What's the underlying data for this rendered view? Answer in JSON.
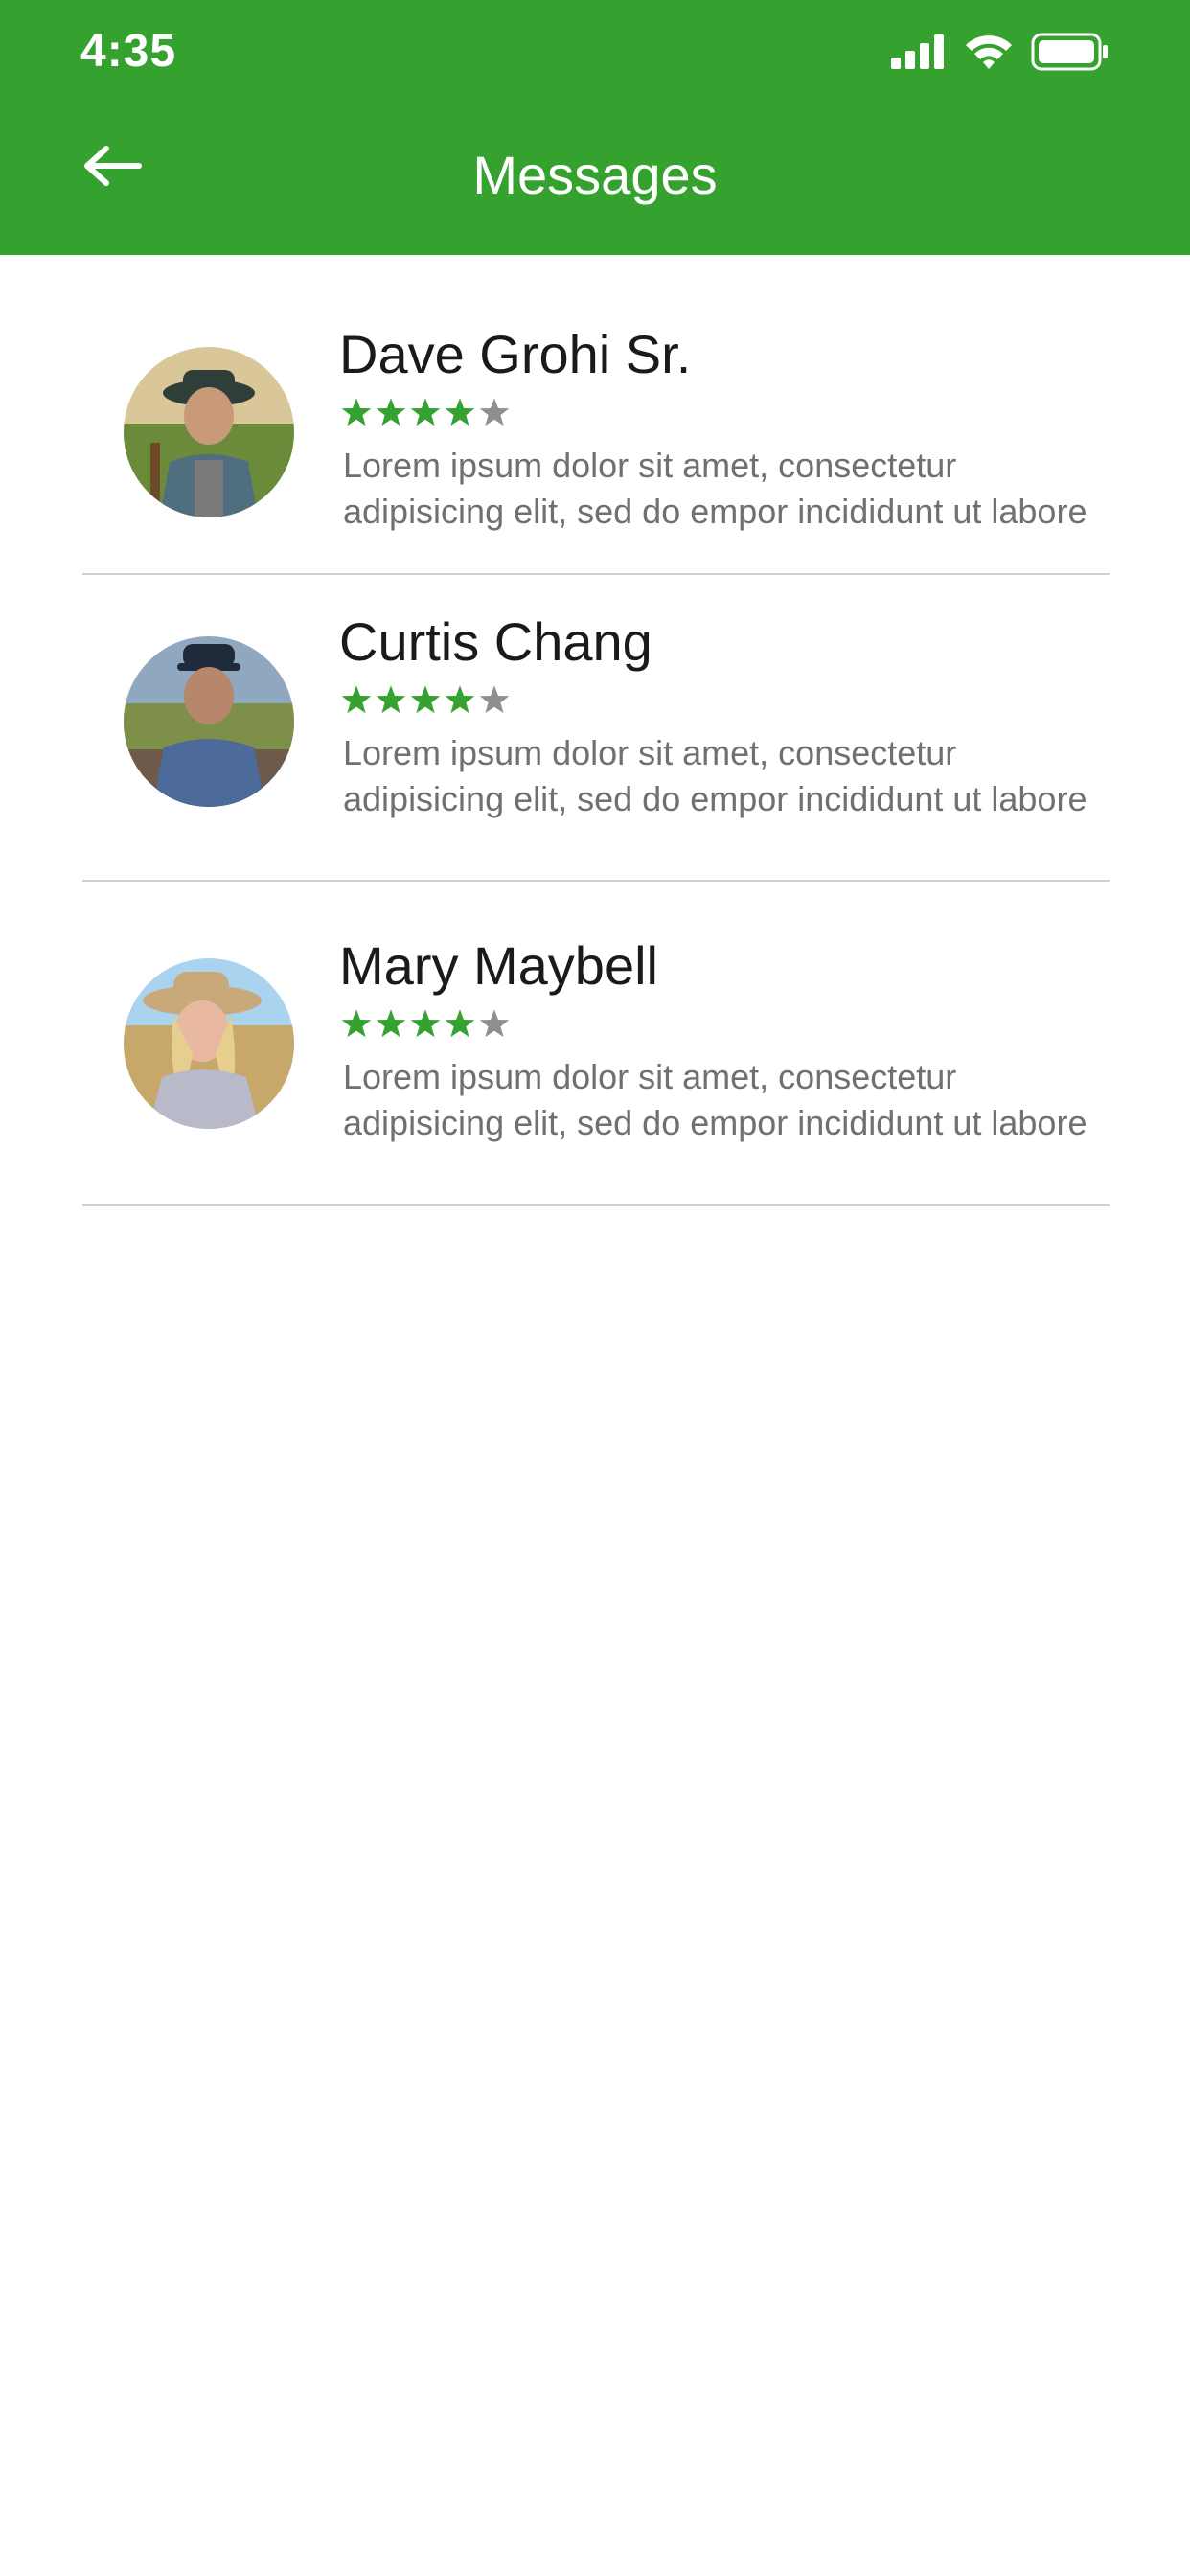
{
  "status_bar": {
    "time": "4:35",
    "icons": [
      "cellular-signal-icon",
      "wifi-icon",
      "battery-icon"
    ]
  },
  "header": {
    "title": "Messages",
    "back_icon": "arrow-left-icon",
    "background_color": "#35a22f"
  },
  "colors": {
    "accent": "#35a22f",
    "star_filled": "#35a22f",
    "star_empty": "#8f8f8f",
    "name_text": "#1a1a1a",
    "preview_text": "#707070",
    "divider": "#cfcfcf"
  },
  "messages": [
    {
      "name": "Dave Grohi Sr.",
      "rating": 4,
      "rating_max": 5,
      "preview": "Lorem ipsum dolor sit amet, consectetur adipisicing elit, sed do empor incididunt ut labore"
    },
    {
      "name": "Curtis Chang",
      "rating": 4,
      "rating_max": 5,
      "preview": "Lorem ipsum dolor sit amet, consectetur adipisicing elit, sed do empor incididunt ut labore"
    },
    {
      "name": "Mary Maybell",
      "rating": 4,
      "rating_max": 5,
      "preview": "Lorem ipsum dolor sit amet, consectetur adipisicing elit, sed do empor incididunt ut labore"
    }
  ]
}
